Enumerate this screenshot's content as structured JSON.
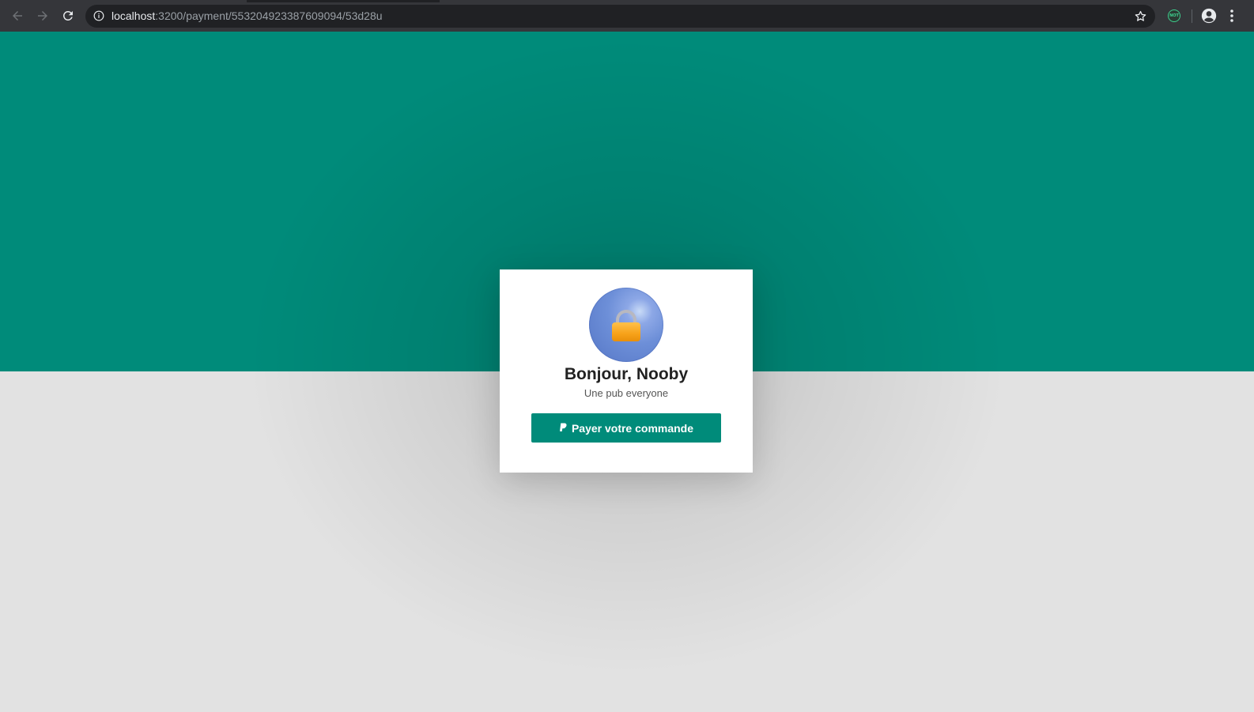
{
  "browser": {
    "url_host": "localhost",
    "url_path": ":3200/payment/553204923387609094/53d28u",
    "icons": {
      "back": "arrow-left-icon",
      "forward": "arrow-right-icon",
      "reload": "reload-icon",
      "site_info": "info-icon",
      "bookmark": "star-icon",
      "extension": "extension-icon",
      "profile": "account-circle-icon",
      "menu": "more-vert-icon"
    },
    "extension_badge": "NOT"
  },
  "page": {
    "colors": {
      "accent": "#008b7a",
      "bottom_background": "#e2e2e2",
      "card_background": "#ffffff"
    },
    "card": {
      "avatar_icon": "lock-icon",
      "greeting": "Bonjour, Nooby",
      "subtitle": "Une pub everyone",
      "pay_button": {
        "icon": "paypal-icon",
        "label": "Payer votre commande"
      }
    }
  }
}
